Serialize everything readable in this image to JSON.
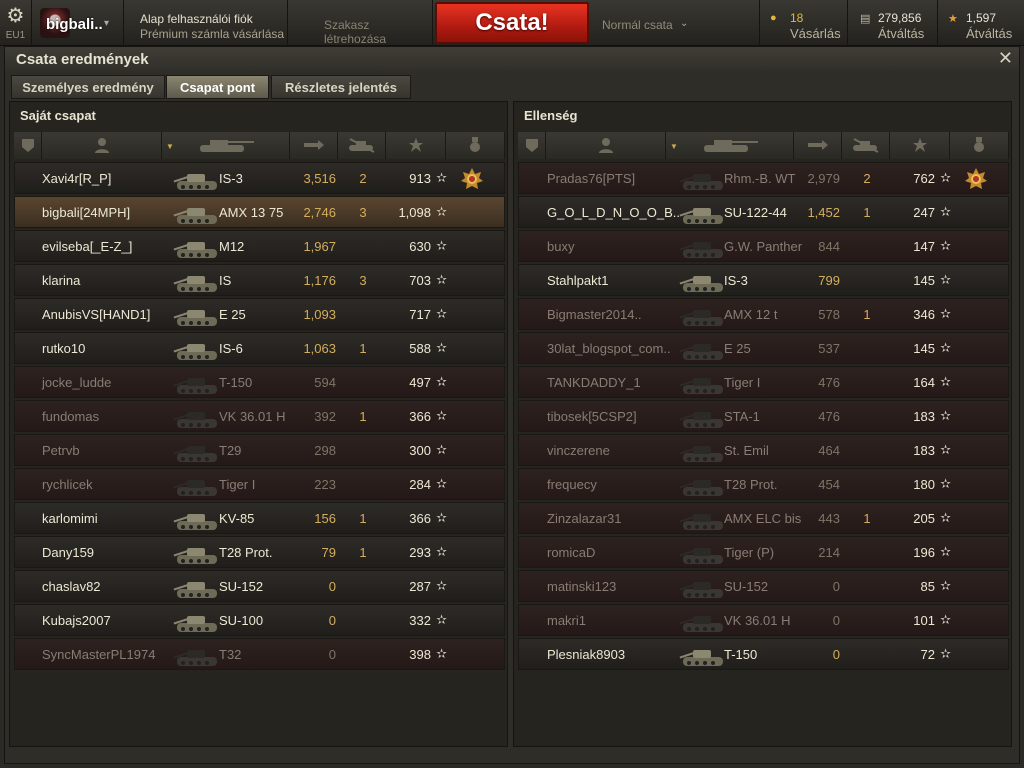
{
  "topbar": {
    "server": "EU1",
    "player_name": "bigbali..",
    "account_line1": "Alap felhasználói fiók",
    "account_line2": "Prémium számla vásárlása",
    "platoon": "Szakasz létrehozása",
    "battle_button": "Csata!",
    "battle_mode": "Normál csata",
    "gold_value": "18",
    "gold_label": "Vásárlás",
    "credits_value": "279,856",
    "credits_label": "Átváltás",
    "xp_value": "1,597",
    "xp_label": "Átváltás",
    "icons": {
      "settings": "gear-icon",
      "gold": "gold-coin-icon",
      "credits": "credits-icon",
      "xp": "free-xp-star-icon"
    },
    "colors": {
      "battle_button": "#c9241a",
      "gold": "#e3b73a"
    }
  },
  "window": {
    "title": "Csata eredmények",
    "tabs": [
      {
        "label": "Személyes eredmény",
        "active": false
      },
      {
        "label": "Csapat pont",
        "active": true
      },
      {
        "label": "Részletes jelentés",
        "active": false
      }
    ]
  },
  "columns": [
    "squad-icon",
    "player-icon",
    "tank-icon",
    "damage-icon",
    "kills-icon",
    "xp-star-icon",
    "medal-icon"
  ],
  "own_team": {
    "title": "Saját csapat",
    "rows": [
      {
        "name": "Xavi4r[R_P]",
        "tank": "IS-3",
        "damage": "3,516",
        "kills": "2",
        "xp": "913",
        "dead": false,
        "me": false,
        "medal": true
      },
      {
        "name": "bigbali[24MPH]",
        "tank": "AMX 13 75",
        "damage": "2,746",
        "kills": "3",
        "xp": "1,098",
        "dead": false,
        "me": true,
        "medal": false
      },
      {
        "name": "evilseba[_E-Z_]",
        "tank": "M12",
        "damage": "1,967",
        "kills": "",
        "xp": "630",
        "dead": false,
        "me": false,
        "medal": false
      },
      {
        "name": "klarina",
        "tank": "IS",
        "damage": "1,176",
        "kills": "3",
        "xp": "703",
        "dead": false,
        "me": false,
        "medal": false
      },
      {
        "name": "AnubisVS[HAND1]",
        "tank": "E 25",
        "damage": "1,093",
        "kills": "",
        "xp": "717",
        "dead": false,
        "me": false,
        "medal": false
      },
      {
        "name": "rutko10",
        "tank": "IS-6",
        "damage": "1,063",
        "kills": "1",
        "xp": "588",
        "dead": false,
        "me": false,
        "medal": false
      },
      {
        "name": "jocke_ludde",
        "tank": "T-150",
        "damage": "594",
        "kills": "",
        "xp": "497",
        "dead": true,
        "me": false,
        "medal": false
      },
      {
        "name": "fundomas",
        "tank": "VK 36.01 H",
        "damage": "392",
        "kills": "1",
        "xp": "366",
        "dead": true,
        "me": false,
        "medal": false
      },
      {
        "name": "Petrvb",
        "tank": "T29",
        "damage": "298",
        "kills": "",
        "xp": "300",
        "dead": true,
        "me": false,
        "medal": false
      },
      {
        "name": "rychlicek",
        "tank": "Tiger I",
        "damage": "223",
        "kills": "",
        "xp": "284",
        "dead": true,
        "me": false,
        "medal": false
      },
      {
        "name": "karlomimi",
        "tank": "KV-85",
        "damage": "156",
        "kills": "1",
        "xp": "366",
        "dead": false,
        "me": false,
        "medal": false
      },
      {
        "name": "Dany159",
        "tank": "T28 Prot.",
        "damage": "79",
        "kills": "1",
        "xp": "293",
        "dead": false,
        "me": false,
        "medal": false
      },
      {
        "name": "chaslav82",
        "tank": "SU-152",
        "damage": "0",
        "kills": "",
        "xp": "287",
        "dead": false,
        "me": false,
        "medal": false
      },
      {
        "name": "Kubajs2007",
        "tank": "SU-100",
        "damage": "0",
        "kills": "",
        "xp": "332",
        "dead": false,
        "me": false,
        "medal": false
      },
      {
        "name": "SyncMasterPL1974",
        "tank": "T32",
        "damage": "0",
        "kills": "",
        "xp": "398",
        "dead": true,
        "me": false,
        "medal": false
      }
    ]
  },
  "enemy_team": {
    "title": "Ellenség",
    "rows": [
      {
        "name": "Pradas76[PTS]",
        "tank": "Rhm.-B. WT",
        "damage": "2,979",
        "kills": "2",
        "xp": "762",
        "dead": true,
        "me": false,
        "medal": true
      },
      {
        "name": "G_O_L_D_N_O_O_B..",
        "tank": "SU-122-44",
        "damage": "1,452",
        "kills": "1",
        "xp": "247",
        "dead": false,
        "me": false,
        "medal": false
      },
      {
        "name": "buxy",
        "tank": "G.W. Panther",
        "damage": "844",
        "kills": "",
        "xp": "147",
        "dead": true,
        "me": false,
        "medal": false
      },
      {
        "name": "Stahlpakt1",
        "tank": "IS-3",
        "damage": "799",
        "kills": "",
        "xp": "145",
        "dead": false,
        "me": false,
        "medal": false
      },
      {
        "name": "Bigmaster2014..",
        "tank": "AMX 12 t",
        "damage": "578",
        "kills": "1",
        "xp": "346",
        "dead": true,
        "me": false,
        "medal": false
      },
      {
        "name": "30lat_blogspot_com..",
        "tank": "E 25",
        "damage": "537",
        "kills": "",
        "xp": "145",
        "dead": true,
        "me": false,
        "medal": false
      },
      {
        "name": "TANKDADDY_1",
        "tank": "Tiger I",
        "damage": "476",
        "kills": "",
        "xp": "164",
        "dead": true,
        "me": false,
        "medal": false
      },
      {
        "name": "tibosek[5CSP2]",
        "tank": "STA-1",
        "damage": "476",
        "kills": "",
        "xp": "183",
        "dead": true,
        "me": false,
        "medal": false
      },
      {
        "name": "vinczerene",
        "tank": "St. Emil",
        "damage": "464",
        "kills": "",
        "xp": "183",
        "dead": true,
        "me": false,
        "medal": false
      },
      {
        "name": "frequecy",
        "tank": "T28 Prot.",
        "damage": "454",
        "kills": "",
        "xp": "180",
        "dead": true,
        "me": false,
        "medal": false
      },
      {
        "name": "Zinzalazar31",
        "tank": "AMX ELC bis",
        "damage": "443",
        "kills": "1",
        "xp": "205",
        "dead": true,
        "me": false,
        "medal": false
      },
      {
        "name": "romicaD",
        "tank": "Tiger (P)",
        "damage": "214",
        "kills": "",
        "xp": "196",
        "dead": true,
        "me": false,
        "medal": false
      },
      {
        "name": "matinski123",
        "tank": "SU-152",
        "damage": "0",
        "kills": "",
        "xp": "85",
        "dead": true,
        "me": false,
        "medal": false
      },
      {
        "name": "makri1",
        "tank": "VK 36.01 H",
        "damage": "0",
        "kills": "",
        "xp": "101",
        "dead": true,
        "me": false,
        "medal": false
      },
      {
        "name": "Plesniak8903",
        "tank": "T-150",
        "damage": "0",
        "kills": "",
        "xp": "72",
        "dead": false,
        "me": false,
        "medal": false
      }
    ]
  }
}
